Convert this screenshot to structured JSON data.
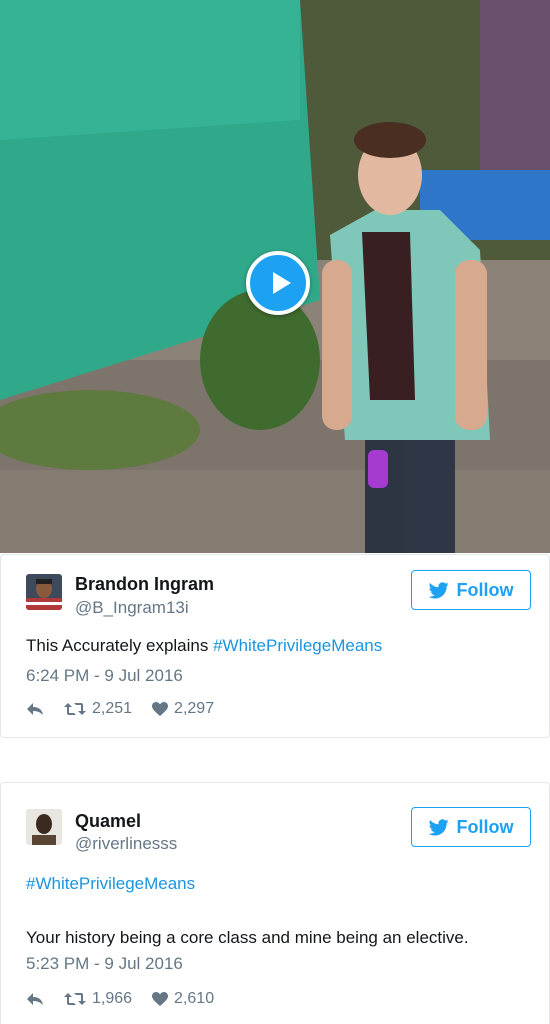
{
  "video": {
    "play_label": "Play video"
  },
  "tweets": [
    {
      "name": "Brandon Ingram",
      "handle": "@B_Ingram13i",
      "follow_label": "Follow",
      "text": "This Accurately explains ",
      "hashtag": "#WhitePrivilegeMeans",
      "time": "6:24 PM - 9 Jul 2016",
      "retweets": "2,251",
      "likes": "2,297"
    },
    {
      "name": "Quamel",
      "handle": "@riverlinesss",
      "follow_label": "Follow",
      "hashtag": "#WhitePrivilegeMeans",
      "text": "Your history being a core class and mine being an elective.",
      "time": "5:23 PM - 9 Jul 2016",
      "retweets": "1,966",
      "likes": "2,610"
    }
  ],
  "colors": {
    "accent": "#1da1f2",
    "hashtag": "#1b95e0",
    "muted": "#657786"
  },
  "icons": [
    "play-icon",
    "twitter-bird-icon",
    "reply-icon",
    "retweet-icon",
    "heart-icon"
  ]
}
